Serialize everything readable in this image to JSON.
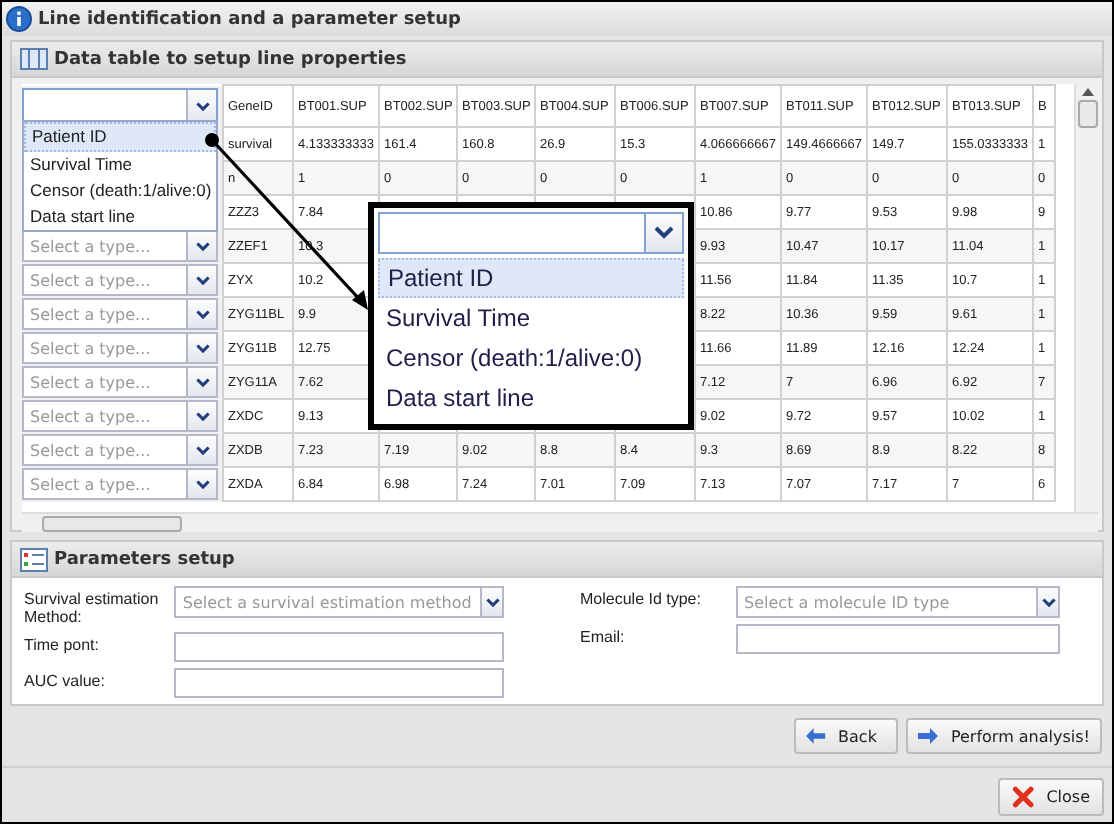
{
  "window": {
    "title": "Line identification and a parameter setup"
  },
  "data_panel": {
    "title": "Data table to setup line properties",
    "type_dropdown": {
      "expanded": true,
      "options": [
        {
          "label": "Patient ID",
          "selected": true
        },
        {
          "label": "Survival Time",
          "selected": false
        },
        {
          "label": "Censor (death:1/alive:0)",
          "selected": false
        },
        {
          "label": "Data start line",
          "selected": false
        }
      ]
    },
    "table": {
      "columns": [
        "GeneID",
        "BT001.SUP",
        "BT002.SUP",
        "BT003.SUP",
        "BT004.SUP",
        "BT006.SUP",
        "BT007.SUP",
        "BT011.SUP",
        "BT012.SUP",
        "BT013.SUP",
        "B"
      ],
      "rows": [
        {
          "cells": [
            "survival",
            "4.133333333",
            "161.4",
            "160.8",
            "26.9",
            "15.3",
            "4.066666667",
            "149.4666667",
            "149.7",
            "155.0333333",
            "1"
          ]
        },
        {
          "cells": [
            "n",
            "1",
            "0",
            "0",
            "0",
            "0",
            "1",
            "0",
            "0",
            "0",
            "0"
          ]
        },
        {
          "cells": [
            "ZZZ3",
            "7.84",
            null,
            null,
            null,
            null,
            "10.86",
            "9.77",
            "9.53",
            "9.98",
            "9"
          ]
        },
        {
          "type_placeholder": "Select a type...",
          "cells": [
            "ZZEF1",
            "10.3",
            null,
            null,
            null,
            null,
            "9.93",
            "10.47",
            "10.17",
            "11.04",
            "1"
          ]
        },
        {
          "type_placeholder": "Select a type...",
          "cells": [
            "ZYX",
            "10.2",
            null,
            null,
            null,
            null,
            "11.56",
            "11.84",
            "11.35",
            "10.7",
            "1"
          ]
        },
        {
          "type_placeholder": "Select a type...",
          "cells": [
            "ZYG11BL",
            "9.9",
            null,
            null,
            null,
            null,
            "8.22",
            "10.36",
            "9.59",
            "9.61",
            "1"
          ]
        },
        {
          "type_placeholder": "Select a type...",
          "cells": [
            "ZYG11B",
            "12.75",
            null,
            null,
            null,
            null,
            "11.66",
            "11.89",
            "12.16",
            "12.24",
            "1"
          ]
        },
        {
          "type_placeholder": "Select a type...",
          "cells": [
            "ZYG11A",
            "7.62",
            null,
            null,
            null,
            null,
            "7.12",
            "7",
            "6.96",
            "6.92",
            "7"
          ]
        },
        {
          "type_placeholder": "Select a type...",
          "cells": [
            "ZXDC",
            "9.13",
            null,
            null,
            null,
            null,
            "9.02",
            "9.72",
            "9.57",
            "10.02",
            "1"
          ]
        },
        {
          "type_placeholder": "Select a type...",
          "cells": [
            "ZXDB",
            "7.23",
            "7.19",
            "9.02",
            "8.8",
            "8.4",
            "9.3",
            "8.69",
            "8.9",
            "8.22",
            "8"
          ]
        },
        {
          "type_placeholder": "Select a type...",
          "cells": [
            "ZXDA",
            "6.84",
            "6.98",
            "7.24",
            "7.01",
            "7.09",
            "7.13",
            "7.07",
            "7.17",
            "7",
            "6"
          ]
        }
      ]
    }
  },
  "callout": {
    "options": [
      {
        "label": "Patient ID",
        "selected": true
      },
      {
        "label": "Survival Time",
        "selected": false
      },
      {
        "label": "Censor (death:1/alive:0)",
        "selected": false
      },
      {
        "label": "Data start line",
        "selected": false
      }
    ]
  },
  "parameters": {
    "title": "Parameters setup",
    "left_fields": [
      {
        "label": "Survival estimation Method:",
        "kind": "select",
        "placeholder": "Select a survival estimation method"
      },
      {
        "label": "Time pont:",
        "kind": "text"
      },
      {
        "label": "AUC value:",
        "kind": "text"
      }
    ],
    "right_fields": [
      {
        "label": "Molecule Id type:",
        "kind": "select",
        "placeholder": "Select a molecule ID type"
      },
      {
        "label": "Email:",
        "kind": "text"
      }
    ]
  },
  "buttons": [
    {
      "label": "Back",
      "kind": "back"
    },
    {
      "label": "Perform analysis!",
      "kind": "forward"
    }
  ],
  "footer_buttons": [
    {
      "label": "Close",
      "kind": "close"
    }
  ]
}
